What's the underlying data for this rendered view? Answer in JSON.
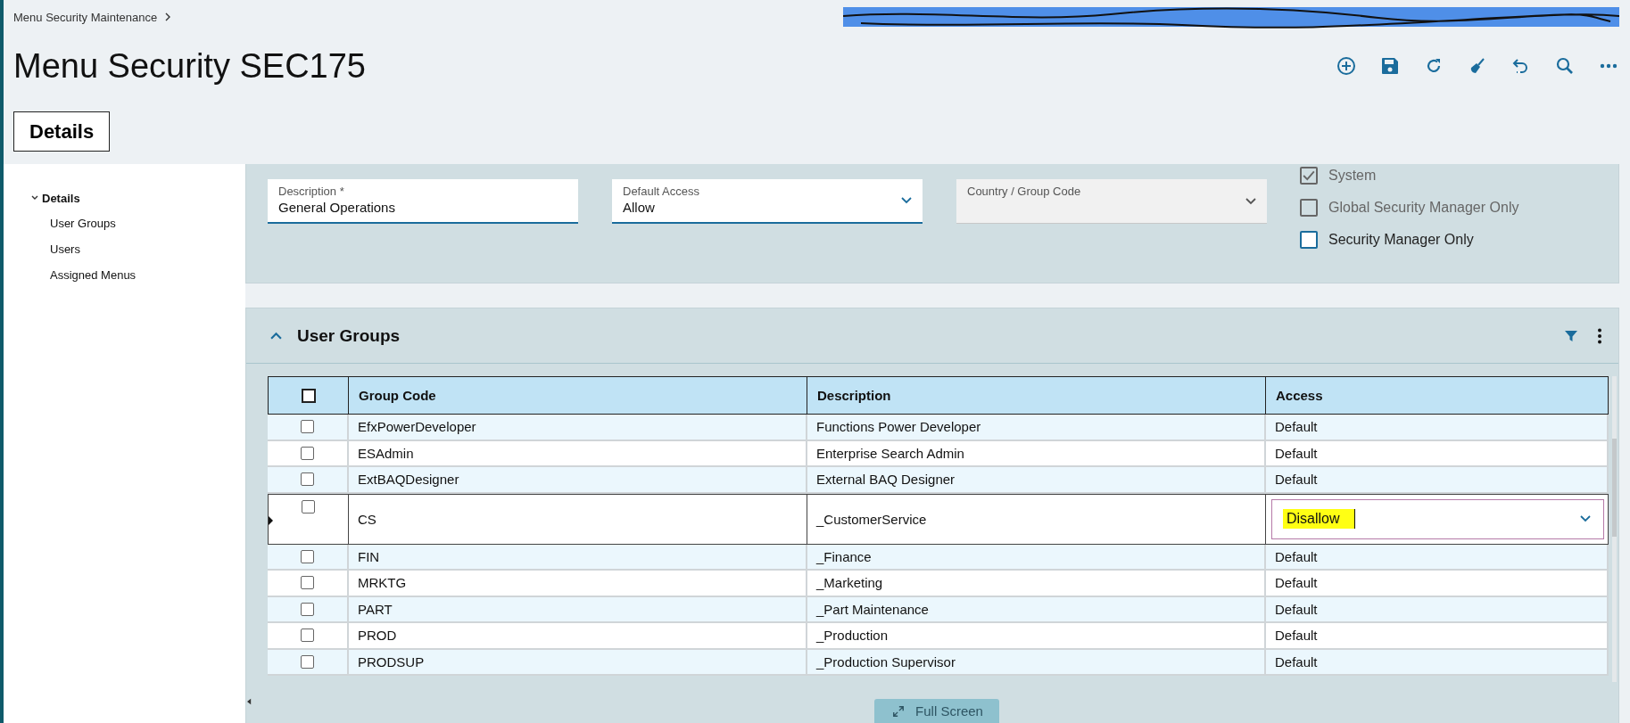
{
  "breadcrumb": {
    "items": [
      {
        "label": "Menu Security Maintenance"
      }
    ]
  },
  "title": "Menu Security SEC175",
  "details_button": {
    "label": "Details"
  },
  "sidebar": {
    "items": [
      {
        "label": "Details",
        "expanded": true,
        "children": [
          {
            "label": "User Groups"
          },
          {
            "label": "Users"
          },
          {
            "label": "Assigned Menus"
          }
        ]
      }
    ]
  },
  "form": {
    "fields": [
      {
        "kind": "text",
        "label": "Description *",
        "value": "General Operations",
        "disabled": false
      },
      {
        "kind": "dropdown",
        "label": "Default Access",
        "value": "Allow",
        "disabled": false
      },
      {
        "kind": "dropdown",
        "label": "Country / Group Code",
        "disabled": true
      }
    ],
    "checkboxes": [
      {
        "label": "System",
        "checked": true,
        "disabled": true
      },
      {
        "label": "Global Security Manager Only",
        "checked": false,
        "disabled": true
      },
      {
        "label": "Security Manager Only",
        "checked": false,
        "disabled": false
      }
    ]
  },
  "user_groups": {
    "title": "User Groups",
    "expanded": true,
    "table": {
      "header_checked": false,
      "columns": [
        "Group Code",
        "Description",
        "Access"
      ],
      "rows": [
        {
          "group_code": "EfxPowerDeveloper",
          "description": "Functions Power Developer",
          "access": "Default",
          "checked": false,
          "selected": false,
          "highlighted": false
        },
        {
          "group_code": "ESAdmin",
          "description": "Enterprise Search Admin",
          "access": "Default",
          "checked": false,
          "selected": false,
          "highlighted": false
        },
        {
          "group_code": "ExtBAQDesigner",
          "description": "External BAQ Designer",
          "access": "Default",
          "checked": false,
          "selected": false,
          "highlighted": false
        },
        {
          "group_code": "CS",
          "description": "_CustomerService",
          "access": "Disallow",
          "checked": false,
          "selected": true,
          "highlighted": true
        },
        {
          "group_code": "FIN",
          "description": "_Finance",
          "access": "Default",
          "checked": false,
          "selected": false,
          "highlighted": false
        },
        {
          "group_code": "MRKTG",
          "description": "_Marketing",
          "access": "Default",
          "checked": false,
          "selected": false,
          "highlighted": false
        },
        {
          "group_code": "PART",
          "description": "_Part Maintenance",
          "access": "Default",
          "checked": false,
          "selected": false,
          "highlighted": false
        },
        {
          "group_code": "PROD",
          "description": "_Production",
          "access": "Default",
          "checked": false,
          "selected": false,
          "highlighted": false
        },
        {
          "group_code": "PRODSUP",
          "description": "_Production Supervisor",
          "access": "Default",
          "checked": false,
          "selected": false,
          "highlighted": false
        }
      ]
    }
  },
  "full_screen_button": {
    "label": "Full Screen"
  }
}
